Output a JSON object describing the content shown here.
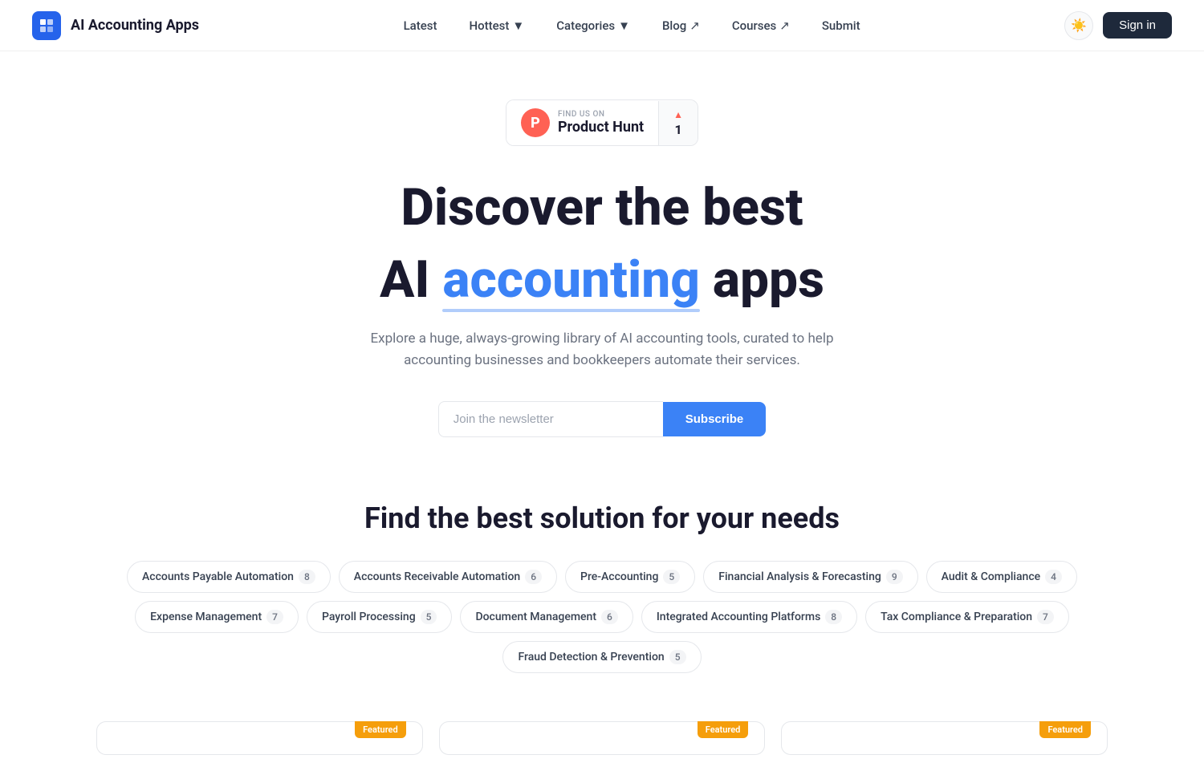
{
  "header": {
    "logo_text": "AI Accounting Apps",
    "nav": [
      {
        "label": "Latest",
        "has_arrow": false
      },
      {
        "label": "Hottest",
        "has_arrow": true
      },
      {
        "label": "Categories",
        "has_arrow": true
      },
      {
        "label": "Blog",
        "has_arrow": true
      },
      {
        "label": "Courses",
        "has_arrow": true
      },
      {
        "label": "Submit",
        "has_arrow": false
      }
    ],
    "sign_in": "Sign in"
  },
  "product_hunt": {
    "find_us_on": "FIND US ON",
    "name": "Product Hunt",
    "count": "1"
  },
  "hero": {
    "title_line1": "Discover the best",
    "title_line2_prefix": "AI ",
    "title_accent": "accounting",
    "title_line2_suffix": " apps",
    "description_line1": "Explore a huge, always-growing library of AI accounting tools, curated to help",
    "description_line2": "accounting businesses and bookkeepers automate their services.",
    "newsletter_placeholder": "Join the newsletter",
    "subscribe_label": "Subscribe"
  },
  "categories_section": {
    "title": "Find the best solution for your needs",
    "categories": [
      {
        "label": "Accounts Payable Automation",
        "count": "8"
      },
      {
        "label": "Accounts Receivable Automation",
        "count": "6"
      },
      {
        "label": "Pre-Accounting",
        "count": "5"
      },
      {
        "label": "Financial Analysis & Forecasting",
        "count": "9"
      },
      {
        "label": "Audit & Compliance",
        "count": "4"
      },
      {
        "label": "Expense Management",
        "count": "7"
      },
      {
        "label": "Payroll Processing",
        "count": "5"
      },
      {
        "label": "Document Management",
        "count": "6"
      },
      {
        "label": "Integrated Accounting Platforms",
        "count": "8"
      },
      {
        "label": "Tax Compliance & Preparation",
        "count": "7"
      },
      {
        "label": "Fraud Detection & Prevention",
        "count": "5"
      }
    ]
  },
  "featured": {
    "badge": "Featured"
  }
}
